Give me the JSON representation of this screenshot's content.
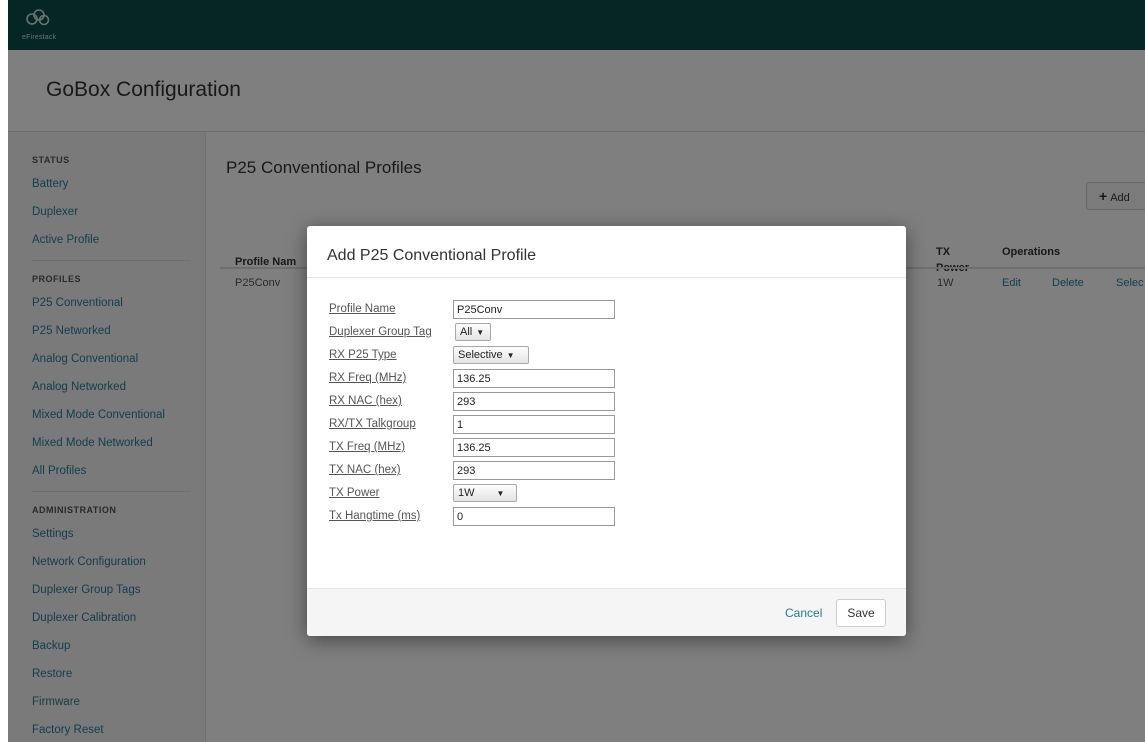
{
  "brand": {
    "logo_text": "eFirestack",
    "bar_color": "#0d4d46"
  },
  "header": {
    "title": "GoBox Configuration"
  },
  "sidebar": {
    "sections": [
      {
        "title": "STATUS",
        "items": [
          "Battery",
          "Duplexer",
          "Active Profile"
        ]
      },
      {
        "title": "PROFILES",
        "items": [
          "P25 Conventional",
          "P25 Networked",
          "Analog Conventional",
          "Analog Networked",
          "Mixed Mode Conventional",
          "Mixed Mode Networked",
          "All Profiles"
        ]
      },
      {
        "title": "ADMINISTRATION",
        "items": [
          "Settings",
          "Network Configuration",
          "Duplexer Group Tags",
          "Duplexer Calibration",
          "Backup",
          "Restore",
          "Firmware",
          "Factory Reset"
        ]
      }
    ]
  },
  "main": {
    "page_title": "P25 Conventional Profiles",
    "add_button_label": "Add",
    "table": {
      "headers": {
        "profile_name": "Profile Nam",
        "tx_power_line1": "TX",
        "tx_power_line2": "Power",
        "operations": "Operations"
      },
      "rows": [
        {
          "profile_name": "P25Conv",
          "tx_power": "1W",
          "edit": "Edit",
          "delete": "Delete",
          "select": "Selec"
        }
      ]
    }
  },
  "modal": {
    "title": "Add P25 Conventional Profile",
    "fields": {
      "profile_name": {
        "label": "Profile Name",
        "value": "P25Conv"
      },
      "duplexer_group_tag": {
        "label": "Duplexer Group Tag",
        "value": "All"
      },
      "rx_p25_type": {
        "label": "RX P25 Type",
        "value": "Selective"
      },
      "rx_freq": {
        "label": "RX Freq (MHz)",
        "value": "136.25"
      },
      "rx_nac": {
        "label": "RX NAC (hex)",
        "value": "293"
      },
      "rx_tx_talkgroup": {
        "label": "RX/TX Talkgroup",
        "value": "1"
      },
      "tx_freq": {
        "label": "TX Freq (MHz)",
        "value": "136.25"
      },
      "tx_nac": {
        "label": "TX NAC (hex)",
        "value": "293"
      },
      "tx_power": {
        "label": "TX Power",
        "value": "1W"
      },
      "tx_hangtime": {
        "label": "Tx Hangtime (ms)",
        "value": "0"
      }
    },
    "cancel_label": "Cancel",
    "save_label": "Save"
  }
}
